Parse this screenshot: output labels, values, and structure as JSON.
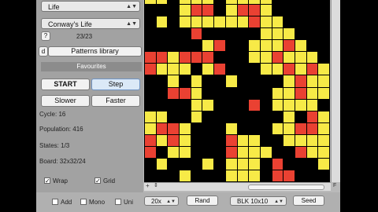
{
  "panel": {
    "rule_select": "Life",
    "pattern_select": "Conway's Life",
    "pattern_counter": "23/23",
    "prev_label": "?",
    "small_label": "d",
    "library_button": "Patterns library",
    "favourites_header": "Favourites",
    "start_button": "START",
    "step_button": "Step",
    "slower_button": "Slower",
    "faster_button": "Faster",
    "cycle": "Cycle: 16",
    "population": "Population: 416",
    "states": "States: 1/3",
    "board": "Board: 32x32/24",
    "wrap_label": "Wrap",
    "grid_label": "Grid",
    "check_mark": "✓"
  },
  "bottom": {
    "add_label": "Add",
    "mono_label": "Mono",
    "uni_label": "Uni",
    "zoom_value": "20x",
    "rand_button": "Rand",
    "blk_value": "BLK 10x10",
    "seed_button": "Seed"
  },
  "scroll": {
    "plus": "+",
    "arrow": "⇕",
    "corner": "F"
  },
  "colors": {
    "alive": "#f7ea47",
    "dying": "#ea4132",
    "dead": "#000000"
  },
  "board_rows": [
    "YY.YYY.YYYY.....",
    "...YRR.YRRY.....",
    ".Y.YYYYYYRYY....",
    "....R.....YYY...",
    ".....YR..YYYRY..",
    "RRYRRR...YYRYYY.",
    "RYYY.YR...YYRYRY",
    "..Y.Y..Y....YRYY",
    "..RRY......YYRYY",
    "....YY...R.YYYY.",
    "YY..Y.......Y.RY",
    "YRRY...Y...YYRRY",
    "RYRY...RYY..YYYY",
    "R.YY...RYYY..RYY",
    ".Y...Y.YYY.R...Y",
    "...Y...YYY.RR..."
  ]
}
